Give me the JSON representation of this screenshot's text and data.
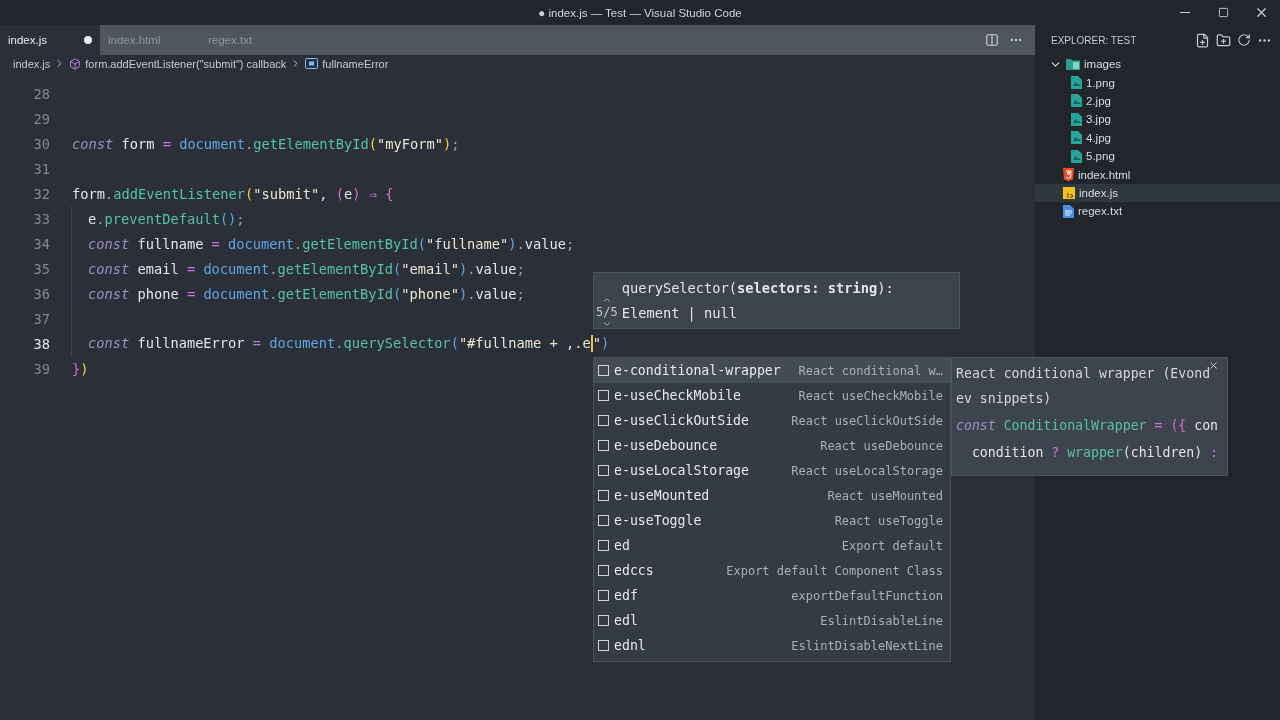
{
  "window": {
    "title": "● index.js — Test — Visual Studio Code"
  },
  "tabs": [
    {
      "label": "index.js",
      "selected": true,
      "dirty": true
    },
    {
      "label": "index.html",
      "selected": false,
      "dirty": false
    },
    {
      "label": "regex.txt",
      "selected": false,
      "dirty": false
    }
  ],
  "breadcrumb": [
    {
      "label": "index.js",
      "kind": "file"
    },
    {
      "label": "form.addEventListener(\"submit\") callback",
      "kind": "method"
    },
    {
      "label": "fullnameError",
      "kind": "variable"
    }
  ],
  "editor": {
    "lines": [
      {
        "number": "28",
        "indented": false,
        "current": false
      },
      {
        "number": "29",
        "indented": false,
        "current": false
      },
      {
        "number": "30",
        "indented": false,
        "current": false,
        "tokens": [
          {
            "text": "const",
            "kind": "kw"
          },
          {
            "text": " form ",
            "kind": "id"
          },
          {
            "text": "= ",
            "kind": "op"
          },
          {
            "text": "document",
            "kind": "obj"
          },
          {
            "text": ".",
            "kind": "punc"
          },
          {
            "text": "getElementById",
            "kind": "fn"
          },
          {
            "text": "(",
            "kind": "br1"
          },
          {
            "text": "\"myForm\"",
            "kind": "str"
          },
          {
            "text": ")",
            "kind": "br1"
          },
          {
            "text": ";",
            "kind": "punc"
          }
        ]
      },
      {
        "number": "31",
        "indented": false,
        "current": false
      },
      {
        "number": "32",
        "indented": false,
        "current": false,
        "tokens": [
          {
            "text": "form",
            "kind": "id"
          },
          {
            "text": ".",
            "kind": "punc"
          },
          {
            "text": "addEventListener",
            "kind": "fn"
          },
          {
            "text": "(",
            "kind": "br1"
          },
          {
            "text": "\"submit\"",
            "kind": "str"
          },
          {
            "text": ", ",
            "kind": "id"
          },
          {
            "text": "(",
            "kind": "br2"
          },
          {
            "text": "e",
            "kind": "id"
          },
          {
            "text": ")",
            "kind": "br2"
          },
          {
            "text": " ⇒ ",
            "kind": "op"
          },
          {
            "text": "{",
            "kind": "br2"
          }
        ]
      },
      {
        "number": "33",
        "indented": true,
        "current": false,
        "tokens": [
          {
            "text": "e",
            "kind": "id"
          },
          {
            "text": ".",
            "kind": "punc"
          },
          {
            "text": "preventDefault",
            "kind": "fn"
          },
          {
            "text": "()",
            "kind": "br3"
          },
          {
            "text": ";",
            "kind": "punc"
          }
        ]
      },
      {
        "number": "34",
        "indented": true,
        "current": false,
        "tokens": [
          {
            "text": "const",
            "kind": "kw"
          },
          {
            "text": " fullname ",
            "kind": "id"
          },
          {
            "text": "= ",
            "kind": "op"
          },
          {
            "text": "document",
            "kind": "obj"
          },
          {
            "text": ".",
            "kind": "punc"
          },
          {
            "text": "getElementById",
            "kind": "fn"
          },
          {
            "text": "(",
            "kind": "br3"
          },
          {
            "text": "\"fullname\"",
            "kind": "str"
          },
          {
            "text": ")",
            "kind": "br3"
          },
          {
            "text": ".",
            "kind": "punc"
          },
          {
            "text": "value",
            "kind": "id"
          },
          {
            "text": ";",
            "kind": "punc"
          }
        ]
      },
      {
        "number": "35",
        "indented": true,
        "current": false,
        "tokens": [
          {
            "text": "const",
            "kind": "kw"
          },
          {
            "text": " email ",
            "kind": "id"
          },
          {
            "text": "= ",
            "kind": "op"
          },
          {
            "text": "document",
            "kind": "obj"
          },
          {
            "text": ".",
            "kind": "punc"
          },
          {
            "text": "getElementById",
            "kind": "fn"
          },
          {
            "text": "(",
            "kind": "br3"
          },
          {
            "text": "\"email\"",
            "kind": "str"
          },
          {
            "text": ")",
            "kind": "br3"
          },
          {
            "text": ".",
            "kind": "punc"
          },
          {
            "text": "value",
            "kind": "id"
          },
          {
            "text": ";",
            "kind": "punc"
          }
        ]
      },
      {
        "number": "36",
        "indented": true,
        "current": false,
        "tokens": [
          {
            "text": "const",
            "kind": "kw"
          },
          {
            "text": " phone ",
            "kind": "id"
          },
          {
            "text": "= ",
            "kind": "op"
          },
          {
            "text": "document",
            "kind": "obj"
          },
          {
            "text": ".",
            "kind": "punc"
          },
          {
            "text": "getElementById",
            "kind": "fn"
          },
          {
            "text": "(",
            "kind": "br3"
          },
          {
            "text": "\"phone\"",
            "kind": "str"
          },
          {
            "text": ")",
            "kind": "br3"
          },
          {
            "text": ".",
            "kind": "punc"
          },
          {
            "text": "value",
            "kind": "id"
          },
          {
            "text": ";",
            "kind": "punc"
          }
        ]
      },
      {
        "number": "37",
        "indented": true,
        "current": false
      },
      {
        "number": "38",
        "indented": true,
        "current": true,
        "tokens": [
          {
            "text": "const",
            "kind": "kw"
          },
          {
            "text": " fullnameError ",
            "kind": "id"
          },
          {
            "text": "= ",
            "kind": "op"
          },
          {
            "text": "document",
            "kind": "obj"
          },
          {
            "text": ".",
            "kind": "punc"
          },
          {
            "text": "querySelector",
            "kind": "fn"
          },
          {
            "text": "(",
            "kind": "br3"
          },
          {
            "text": "\"#fullname + ,.e",
            "kind": "str"
          },
          {
            "text": "\"",
            "kind": "str"
          },
          {
            "text": ")",
            "kind": "br3"
          }
        ]
      },
      {
        "number": "39",
        "indented": false,
        "current": false,
        "tokens": [
          {
            "text": "}",
            "kind": "br2"
          },
          {
            "text": ")",
            "kind": "br1"
          }
        ]
      }
    ]
  },
  "hover": {
    "counter": "5/5",
    "signature": "querySelector(**selectors: string**): Element | null"
  },
  "suggestions": [
    {
      "label": "e-conditional-wrapper",
      "detail": "React conditional w…",
      "selected": true
    },
    {
      "label": "e-useCheckMobile",
      "detail": "React useCheckMobile",
      "selected": false
    },
    {
      "label": "e-useClickOutSide",
      "detail": "React useClickOutSide",
      "selected": false
    },
    {
      "label": "e-useDebounce",
      "detail": "React useDebounce",
      "selected": false
    },
    {
      "label": "e-useLocalStorage",
      "detail": "React useLocalStorage",
      "selected": false
    },
    {
      "label": "e-useMounted",
      "detail": "React useMounted",
      "selected": false
    },
    {
      "label": "e-useToggle",
      "detail": "React useToggle",
      "selected": false
    },
    {
      "label": "ed",
      "detail": "Export default",
      "selected": false
    },
    {
      "label": "edccs",
      "detail": "Export default Component Class",
      "selected": false
    },
    {
      "label": "edf",
      "detail": "exportDefaultFunction",
      "selected": false
    },
    {
      "label": "edl",
      "detail": "EslintDisableLine",
      "selected": false
    },
    {
      "label": "ednl",
      "detail": "EslintDisableNextLine",
      "selected": false
    }
  ],
  "details": {
    "description": "React conditional wrapper (Evondev snippets)",
    "code": [
      [
        {
          "text": "const",
          "kind": "kw"
        },
        {
          "text": " ConditionalWrapper ",
          "kind": "cls"
        },
        {
          "text": "= ",
          "kind": "op"
        },
        {
          "text": "({",
          "kind": "br2"
        },
        {
          "text": " con",
          "kind": "id"
        }
      ],
      [
        {
          "text": "  condition ",
          "kind": "id"
        },
        {
          "text": "? ",
          "kind": "op"
        },
        {
          "text": "wrapper",
          "kind": "fn"
        },
        {
          "text": "(children) ",
          "kind": "id"
        },
        {
          "text": ":",
          "kind": "op"
        }
      ]
    ]
  },
  "explorer": {
    "title": "EXPLORER: TEST",
    "tree": [
      {
        "label": "images",
        "kind": "folder",
        "expanded": true,
        "selected": false,
        "children": [
          {
            "label": "1.png",
            "kind": "image",
            "selected": false
          },
          {
            "label": "2.jpg",
            "kind": "image",
            "selected": false
          },
          {
            "label": "3.jpg",
            "kind": "image",
            "selected": false
          },
          {
            "label": "4.jpg",
            "kind": "image",
            "selected": false
          },
          {
            "label": "5.png",
            "kind": "image",
            "selected": false
          }
        ]
      },
      {
        "label": "index.html",
        "kind": "html",
        "selected": false
      },
      {
        "label": "index.js",
        "kind": "js",
        "selected": true
      },
      {
        "label": "regex.txt",
        "kind": "text",
        "selected": false
      }
    ]
  }
}
